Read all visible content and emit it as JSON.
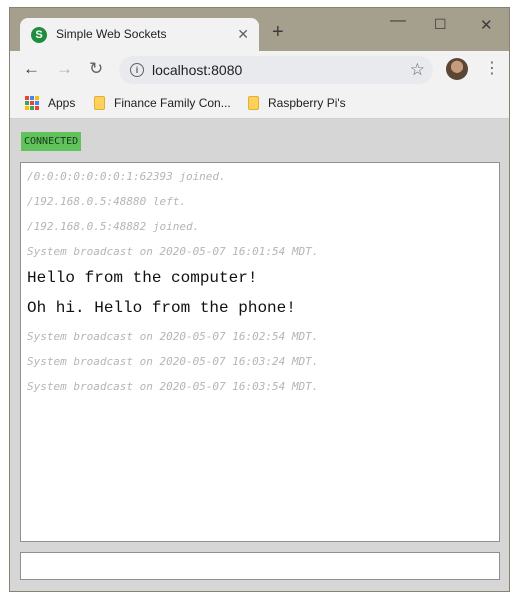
{
  "browser": {
    "tab": {
      "title": "Simple Web Sockets",
      "favicon_letter": "S"
    },
    "new_tab_label": "+",
    "window_controls": {
      "minimize": "—",
      "maximize": "☐",
      "close": "✕"
    },
    "toolbar": {
      "back_glyph": "←",
      "forward_glyph": "→",
      "reload_glyph": "↻",
      "info_glyph": "i",
      "url": "localhost:8080",
      "star_glyph": "☆",
      "menu_glyph": "⋮"
    },
    "bookmarks": [
      {
        "label": "Apps",
        "icon": "apps-grid-icon"
      },
      {
        "label": "Finance Family Con...",
        "icon": "folder-icon"
      },
      {
        "label": "Raspberry Pi's",
        "icon": "folder-icon"
      }
    ]
  },
  "app": {
    "status": "CONNECTED",
    "messages": [
      {
        "type": "system",
        "text": "/0:0:0:0:0:0:0:1:62393 joined."
      },
      {
        "type": "system",
        "text": "/192.168.0.5:48880 left."
      },
      {
        "type": "system",
        "text": "/192.168.0.5:48882 joined."
      },
      {
        "type": "system",
        "text": "System broadcast on 2020-05-07 16:01:54 MDT."
      },
      {
        "type": "chat",
        "text": "Hello from the computer!"
      },
      {
        "type": "chat",
        "text": "Oh hi. Hello from the phone!"
      },
      {
        "type": "system",
        "text": "System broadcast on 2020-05-07 16:02:54 MDT."
      },
      {
        "type": "system",
        "text": "System broadcast on 2020-05-07 16:03:24 MDT."
      },
      {
        "type": "system",
        "text": "System broadcast on 2020-05-07 16:03:54 MDT."
      }
    ],
    "input_value": ""
  },
  "colors": {
    "status_bg": "#5fc25b",
    "system_text": "#b5b5b5",
    "chat_text": "#111111",
    "favicon": "#1e8e3e",
    "frame": "#a59f8d"
  }
}
